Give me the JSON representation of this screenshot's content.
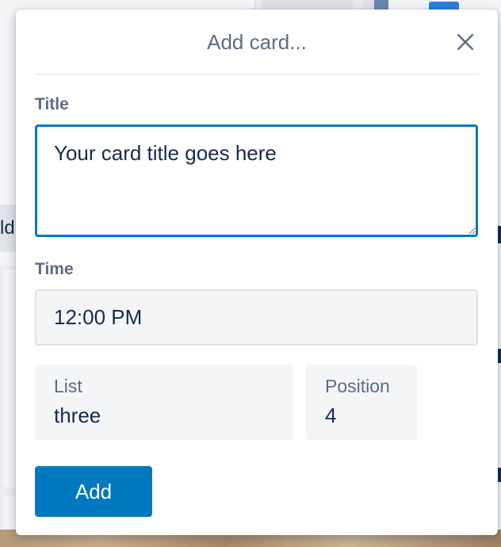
{
  "background": {
    "left_button_text": "ld"
  },
  "dialog": {
    "title": "Add card...",
    "close_icon": "close-icon"
  },
  "fields": {
    "title_label": "Title",
    "title_value": "Your card title goes here",
    "time_label": "Time",
    "time_value": "12:00 PM",
    "list_label": "List",
    "list_value": "three",
    "position_label": "Position",
    "position_value": "4"
  },
  "actions": {
    "add_label": "Add"
  },
  "colors": {
    "accent": "#0079bf",
    "label": "#5e6c84",
    "text": "#172b4d"
  }
}
